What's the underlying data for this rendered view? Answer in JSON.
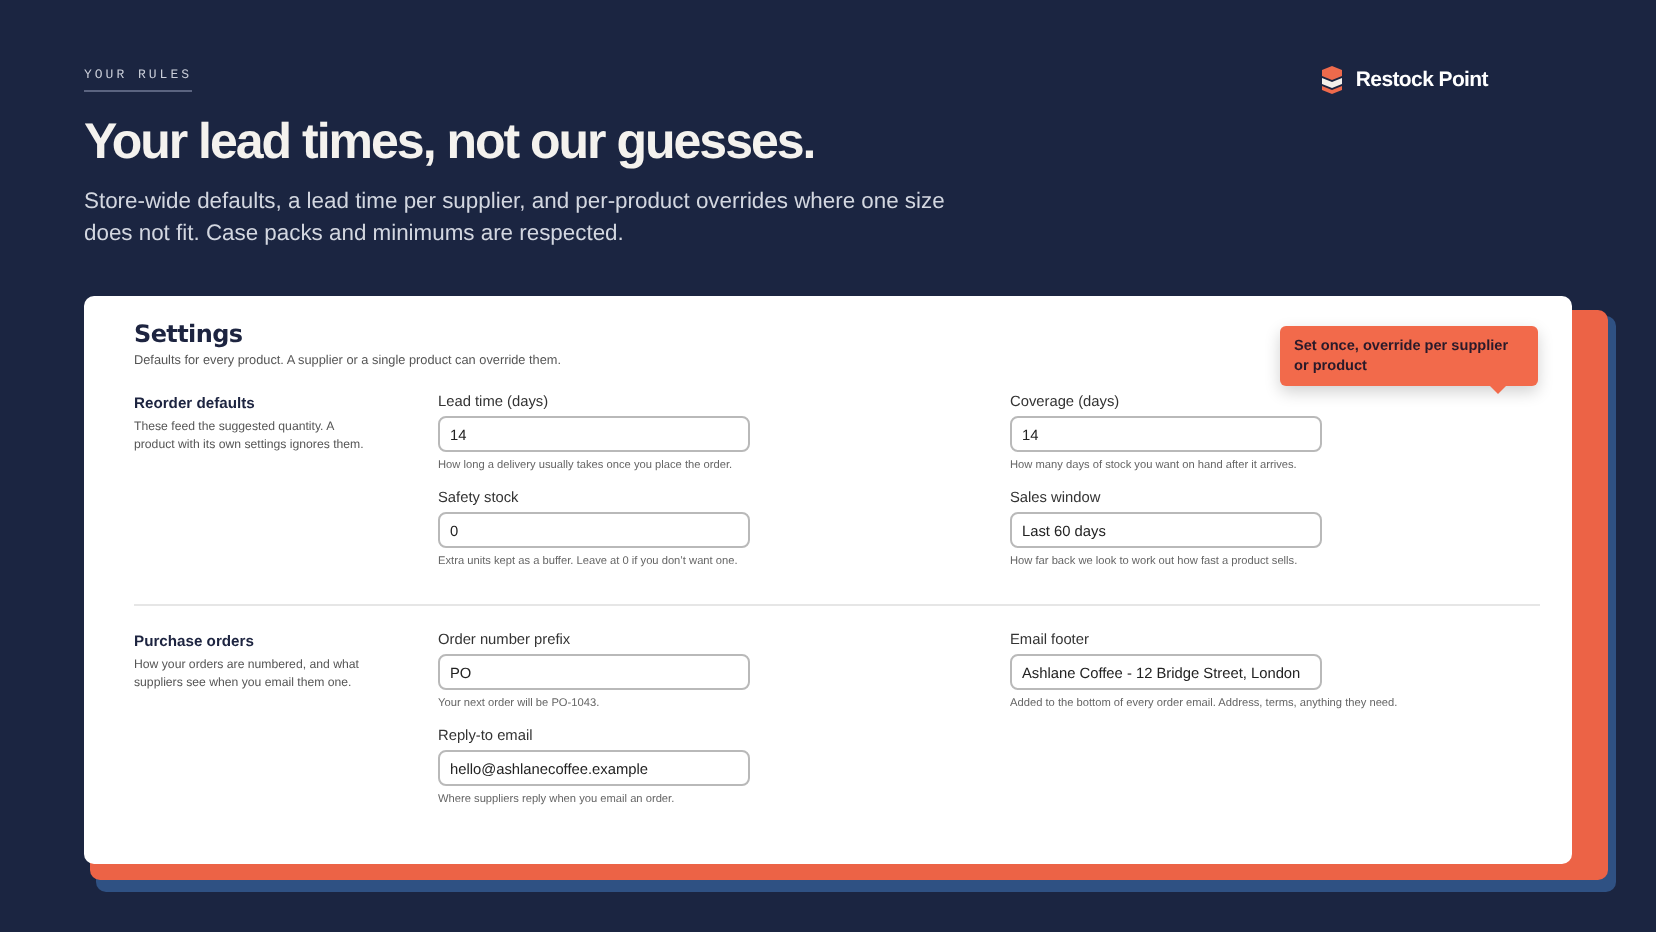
{
  "eyebrow": "YOUR RULES",
  "brand": {
    "name": "Restock Point"
  },
  "headline": "Your lead times, not our guesses.",
  "intro": "Store-wide defaults, a lead time per supplier, and per-product overrides where one size does not fit. Case packs and minimums are respected.",
  "card": {
    "title": "Settings",
    "subtitle": "Defaults for every product. A supplier or a single product can override them.",
    "sections": [
      {
        "title": "Reorder defaults",
        "description": "These feed the suggested quantity. A product with its own settings ignores them.",
        "fields": [
          {
            "label": "Lead time (days)",
            "value": "14",
            "help": "How long a delivery usually takes once you place the order."
          },
          {
            "label": "Coverage (days)",
            "value": "14",
            "help": "How many days of stock you want on hand after it arrives."
          },
          {
            "label": "Safety stock",
            "value": "0",
            "help": "Extra units kept as a buffer. Leave at 0 if you don’t want one."
          },
          {
            "label": "Sales window",
            "value": "Last 60 days",
            "help": "How far back we look to work out how fast a product sells."
          }
        ]
      },
      {
        "title": "Purchase orders",
        "description": "How your orders are numbered, and what suppliers see when you email them one.",
        "fields": [
          {
            "label": "Order number prefix",
            "value": "PO",
            "help": "Your next order will be PO-1043."
          },
          {
            "label": "Email footer",
            "value": "Ashlane Coffee - 12 Bridge Street, London",
            "help": "Added to the bottom of every order email. Address, terms, anything they need."
          },
          {
            "label": "Reply-to email",
            "value": "hello@ashlanecoffee.example",
            "help": "Where suppliers reply when you email an order."
          }
        ]
      }
    ]
  },
  "tooltip": {
    "text": "Set once, override per supplier or product"
  }
}
